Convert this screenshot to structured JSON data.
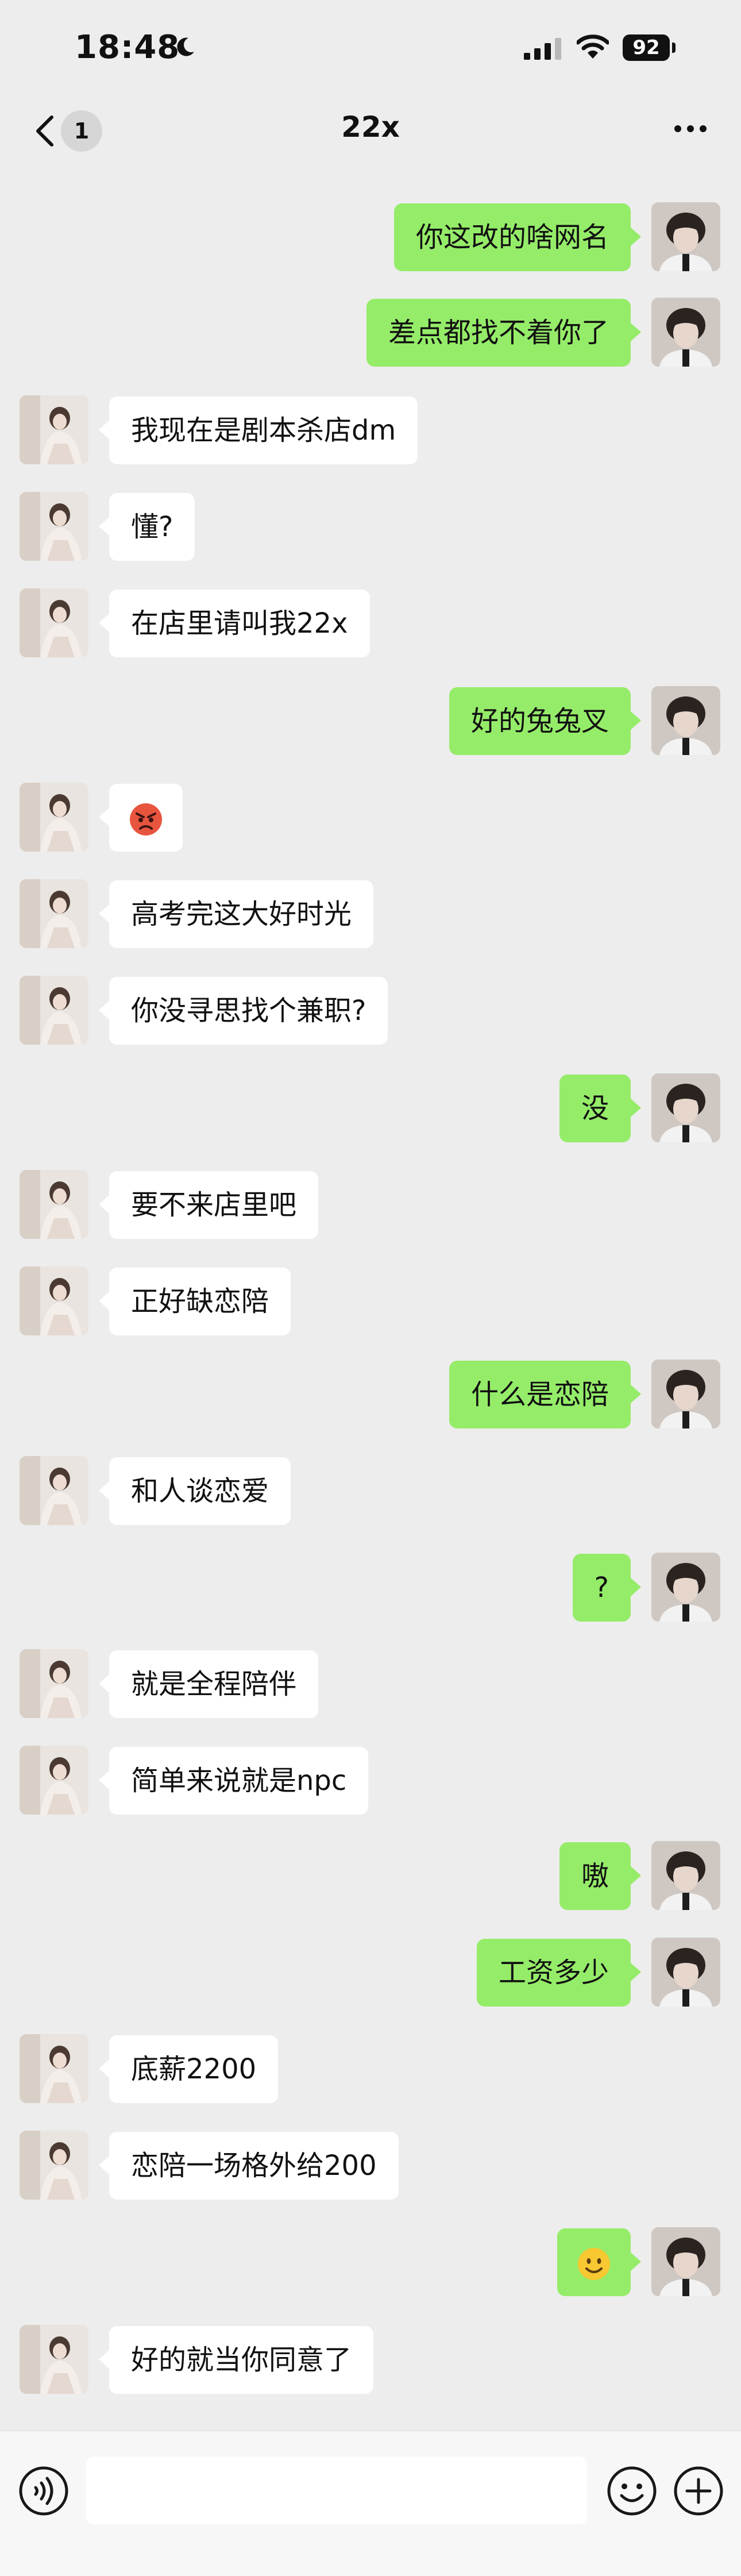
{
  "status_bar": {
    "time": "18:48",
    "battery": "92",
    "icons": [
      "moon-icon",
      "cellular-signal-icon",
      "wifi-icon",
      "battery-icon"
    ]
  },
  "nav": {
    "unread_count": "1",
    "title": "22x",
    "icons": [
      "back-chevron-icon",
      "more-icon"
    ]
  },
  "messages": [
    {
      "side": "right",
      "text": "你这改的啥网名"
    },
    {
      "side": "right",
      "text": "差点都找不着你了"
    },
    {
      "side": "left",
      "text": "我现在是剧本杀店dm"
    },
    {
      "side": "left",
      "text": "懂?"
    },
    {
      "side": "left",
      "text": "在店里请叫我22x"
    },
    {
      "side": "right",
      "text": "好的兔兔叉"
    },
    {
      "side": "left",
      "text": "",
      "emoji": "angry-face-emoji"
    },
    {
      "side": "left",
      "text": "高考完这大好时光"
    },
    {
      "side": "left",
      "text": "你没寻思找个兼职?"
    },
    {
      "side": "right",
      "text": "没"
    },
    {
      "side": "left",
      "text": "要不来店里吧"
    },
    {
      "side": "left",
      "text": "正好缺恋陪"
    },
    {
      "side": "right",
      "text": "什么是恋陪"
    },
    {
      "side": "left",
      "text": "和人谈恋爱"
    },
    {
      "side": "right",
      "text": "?"
    },
    {
      "side": "left",
      "text": "就是全程陪伴"
    },
    {
      "side": "left",
      "text": "简单来说就是npc"
    },
    {
      "side": "right",
      "text": "嗷"
    },
    {
      "side": "right",
      "text": "工资多少"
    },
    {
      "side": "left",
      "text": "底薪2200"
    },
    {
      "side": "left",
      "text": "恋陪一场格外给200"
    },
    {
      "side": "right",
      "text": "",
      "emoji": "smiling-face-emoji"
    },
    {
      "side": "left",
      "text": "好的就当你同意了"
    }
  ],
  "input_bar": {
    "input_value": "",
    "icons": [
      "voice-icon",
      "emoji-icon",
      "plus-icon"
    ]
  },
  "colors": {
    "background": "#ededed",
    "sent_bubble": "#95ec69",
    "received_bubble": "#ffffff"
  }
}
